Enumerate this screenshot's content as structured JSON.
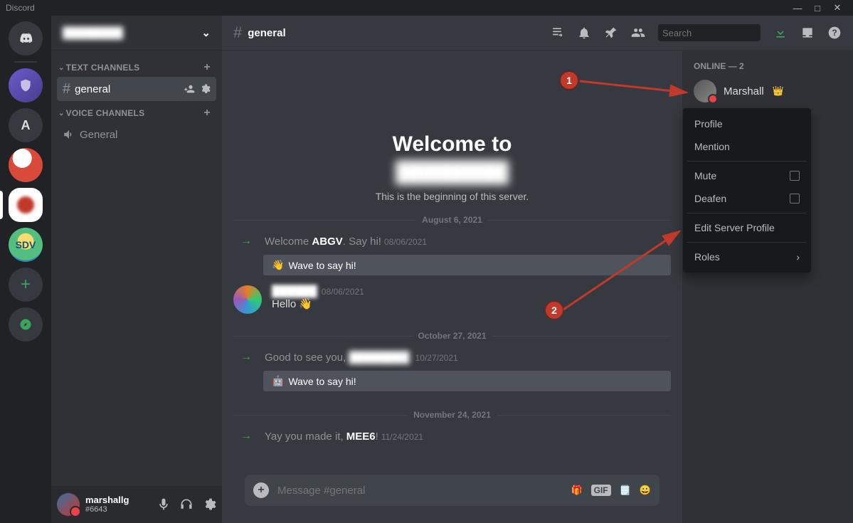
{
  "app_title": "Discord",
  "server_header_name": "████████",
  "sections": {
    "text_channels": "TEXT CHANNELS",
    "voice_channels": "VOICE CHANNELS"
  },
  "channels": {
    "text_active": "general",
    "voice": "General"
  },
  "topbar": {
    "channel": "general",
    "search_placeholder": "Search"
  },
  "welcome": {
    "title": "Welcome to",
    "server_name": "████████",
    "subtitle": "This is the beginning of this server."
  },
  "dates": {
    "d1": "August 6, 2021",
    "d2": "October 27, 2021",
    "d3": "November 24, 2021"
  },
  "sys": {
    "join1_pre": "Welcome ",
    "join1_name": "ABGV",
    "join1_post": ". Say hi!",
    "join1_ts": "08/06/2021",
    "wave_label": "Wave to say hi!",
    "msg2_name": "██████",
    "msg2_ts": "08/06/2021",
    "msg2_text": "Hello 👋",
    "join3_pre": "Good to see you, ",
    "join3_name": "████████",
    "join3_post": "",
    "join3_ts": "10/27/2021",
    "join4_pre": "Yay you made it, ",
    "join4_name": "MEE6",
    "join4_post": "!",
    "join4_ts": "11/24/2021"
  },
  "input_placeholder": "Message #general",
  "members_header": "ONLINE — 2",
  "member1": "Marshall",
  "ctx": {
    "profile": "Profile",
    "mention": "Mention",
    "mute": "Mute",
    "deafen": "Deafen",
    "edit": "Edit Server Profile",
    "roles": "Roles"
  },
  "user": {
    "name": "marshallg",
    "tag": "#6643"
  },
  "annot": {
    "m1": "1",
    "m2": "2"
  },
  "gif_label": "GIF"
}
